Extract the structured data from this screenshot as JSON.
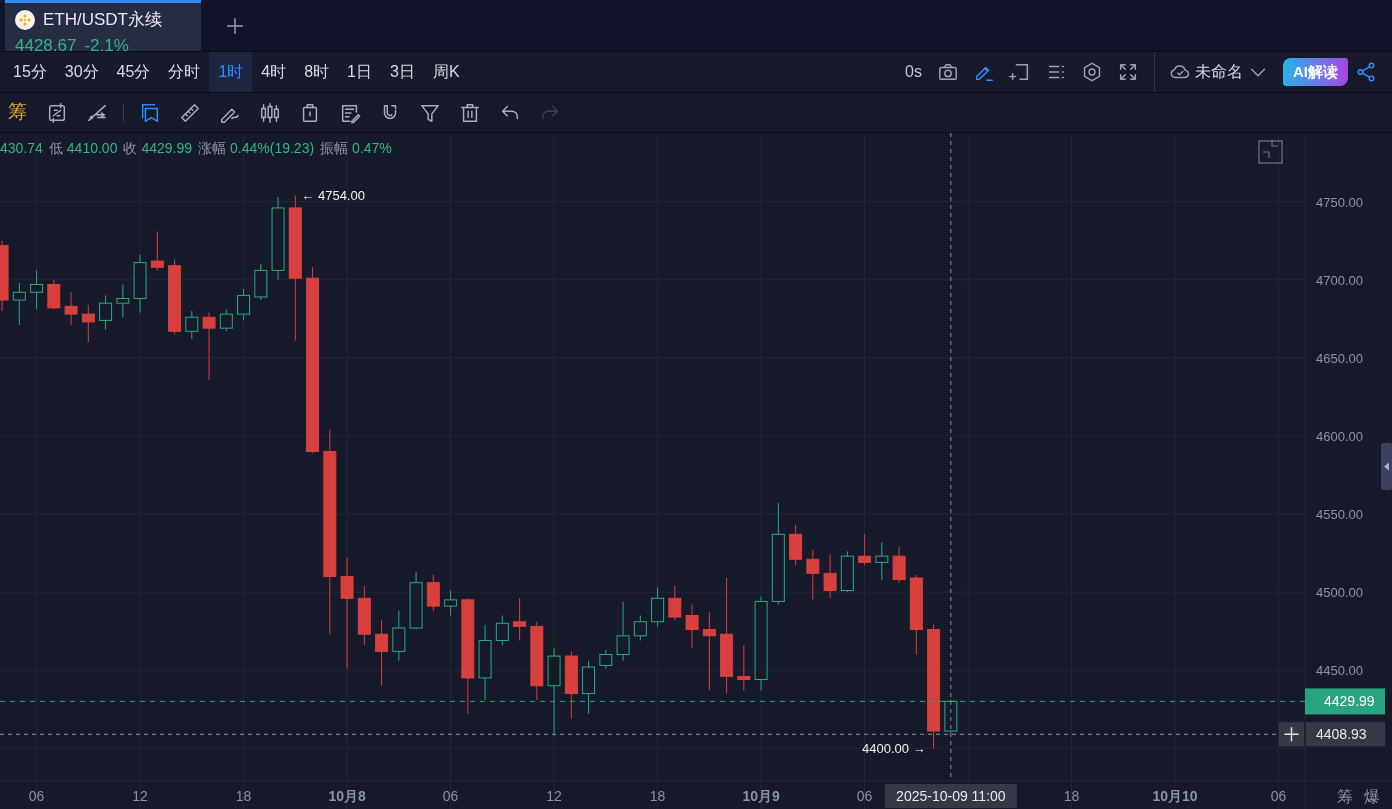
{
  "tabs": [
    {
      "symbol": "ETH/USDT永续",
      "price": "4428.67",
      "change": "-2.1%",
      "selected": true
    }
  ],
  "timeframes": [
    {
      "label": "15分",
      "selected": false
    },
    {
      "label": "30分",
      "selected": false
    },
    {
      "label": "45分",
      "selected": false
    },
    {
      "label": "分时",
      "selected": false
    },
    {
      "label": "1时",
      "selected": true
    },
    {
      "label": "4时",
      "selected": false
    },
    {
      "label": "8时",
      "selected": false
    },
    {
      "label": "1日",
      "selected": false
    },
    {
      "label": "3日",
      "selected": false
    },
    {
      "label": "周K",
      "selected": false
    }
  ],
  "header_tools": {
    "countdown": "0s",
    "icons": [
      {
        "kind": "camera",
        "active": false
      },
      {
        "kind": "pencil",
        "active": true
      },
      {
        "kind": "frame",
        "active": false
      },
      {
        "kind": "list",
        "active": false
      },
      {
        "kind": "settings",
        "active": false
      },
      {
        "kind": "fullscreen",
        "active": false
      }
    ],
    "layout_name": "未命名",
    "ai_button": "AI解读"
  },
  "drawing_toolbar": {
    "chip_label": "筹",
    "tools": [
      {
        "kind": "sync",
        "active": false,
        "disabled": false
      },
      {
        "kind": "trend",
        "active": false,
        "disabled": false
      },
      {
        "kind": "bookmark",
        "active": true,
        "disabled": false
      },
      {
        "kind": "ruler",
        "active": false,
        "disabled": false
      },
      {
        "kind": "brush",
        "active": false,
        "disabled": false
      },
      {
        "kind": "candles",
        "active": false,
        "disabled": false
      },
      {
        "kind": "lock",
        "active": false,
        "disabled": false
      },
      {
        "kind": "note",
        "active": false,
        "disabled": false
      },
      {
        "kind": "magnet",
        "active": false,
        "disabled": false
      },
      {
        "kind": "filter",
        "active": false,
        "disabled": false
      },
      {
        "kind": "trash",
        "active": false,
        "disabled": false
      },
      {
        "kind": "undo",
        "active": false,
        "disabled": false
      },
      {
        "kind": "redo",
        "active": false,
        "disabled": true
      }
    ]
  },
  "ohlc_info": [
    {
      "value": "430.74"
    },
    {
      "label": "低",
      "value": "4410.00"
    },
    {
      "label": "收",
      "value": "4429.99"
    },
    {
      "label": "涨幅",
      "value": "0.44%(19.23)"
    },
    {
      "label": "振幅",
      "value": "0.47%"
    }
  ],
  "chart": {
    "chart_data": {
      "type": "candlestick",
      "ylim": [
        4379,
        4794
      ],
      "yticks": [
        {
          "value": 4450,
          "label": "4450.00"
        },
        {
          "value": 4500,
          "label": "4500.00"
        },
        {
          "value": 4550,
          "label": "4550.00"
        },
        {
          "value": 4600,
          "label": "4600.00"
        },
        {
          "value": 4650,
          "label": "4650.00"
        },
        {
          "value": 4700,
          "label": "4700.00"
        },
        {
          "value": 4750,
          "label": "4750.00"
        }
      ],
      "categories": [
        null,
        null,
        "06",
        null,
        null,
        null,
        null,
        null,
        "12",
        null,
        null,
        null,
        null,
        null,
        "18",
        null,
        null,
        null,
        null,
        null,
        "10月8",
        null,
        null,
        null,
        null,
        null,
        "06",
        null,
        null,
        null,
        null,
        null,
        "12",
        null,
        null,
        null,
        null,
        null,
        "18",
        null,
        null,
        null,
        null,
        null,
        "10月9",
        null,
        null,
        null,
        null,
        null,
        "06",
        null,
        null,
        null,
        null,
        null,
        null,
        null,
        null,
        null,
        null,
        null,
        "18",
        null,
        null,
        null,
        null,
        null,
        "10月10",
        null,
        null,
        null,
        null,
        null,
        "06",
        null
      ],
      "ohlc": [
        [
          4722,
          4725,
          4680,
          4687
        ],
        [
          4687,
          4698,
          4671,
          4692
        ],
        [
          4692,
          4706,
          4681,
          4697
        ],
        [
          4697,
          4700,
          4681,
          4682
        ],
        [
          4683,
          4692,
          4671,
          4678
        ],
        [
          4678,
          4684,
          4660,
          4673
        ],
        [
          4674,
          4690,
          4668,
          4685
        ],
        [
          4685,
          4697,
          4676,
          4688
        ],
        [
          4688,
          4716,
          4679,
          4711
        ],
        [
          4712,
          4731,
          4706,
          4708
        ],
        [
          4709,
          4713,
          4665,
          4667
        ],
        [
          4667,
          4680,
          4662,
          4676
        ],
        [
          4676,
          4679,
          4636,
          4669
        ],
        [
          4669,
          4681,
          4667,
          4678
        ],
        [
          4678,
          4694,
          4674,
          4690
        ],
        [
          4689,
          4710,
          4687,
          4706
        ],
        [
          4706,
          4753,
          4700,
          4746
        ],
        [
          4746,
          4754,
          4661,
          4701
        ],
        [
          4701,
          4708,
          4589,
          4590
        ],
        [
          4590,
          4604,
          4473,
          4510
        ],
        [
          4510,
          4522,
          4451,
          4496
        ],
        [
          4496,
          4504,
          4466,
          4473
        ],
        [
          4473,
          4482,
          4440,
          4462
        ],
        [
          4462,
          4488,
          4456,
          4477
        ],
        [
          4477,
          4513,
          4476,
          4506
        ],
        [
          4506,
          4511,
          4488,
          4491
        ],
        [
          4491,
          4501,
          4485,
          4495
        ],
        [
          4495,
          4496,
          4422,
          4445
        ],
        [
          4445,
          4479,
          4431,
          4469
        ],
        [
          4469,
          4485,
          4466,
          4480
        ],
        [
          4481,
          4496,
          4469,
          4478
        ],
        [
          4478,
          4481,
          4431,
          4440
        ],
        [
          4440,
          4464,
          4408,
          4459
        ],
        [
          4459,
          4462,
          4419,
          4435
        ],
        [
          4435,
          4456,
          4422,
          4452
        ],
        [
          4453,
          4463,
          4451,
          4460
        ],
        [
          4460,
          4494,
          4456,
          4472
        ],
        [
          4472,
          4485,
          4469,
          4481
        ],
        [
          4481,
          4503,
          4478,
          4496
        ],
        [
          4496,
          4504,
          4482,
          4484
        ],
        [
          4485,
          4492,
          4464,
          4476
        ],
        [
          4476,
          4487,
          4437,
          4472
        ],
        [
          4473,
          4509,
          4435,
          4446
        ],
        [
          4446,
          4466,
          4437,
          4444
        ],
        [
          4444,
          4497,
          4437,
          4494
        ],
        [
          4494,
          4557,
          4492,
          4537
        ],
        [
          4537,
          4543,
          4517,
          4521
        ],
        [
          4521,
          4527,
          4495,
          4512
        ],
        [
          4512,
          4524,
          4496,
          4501
        ],
        [
          4501,
          4526,
          4500,
          4523
        ],
        [
          4523,
          4537,
          4517,
          4519
        ],
        [
          4519,
          4532,
          4508,
          4523
        ],
        [
          4523,
          4529,
          4506,
          4508
        ],
        [
          4509,
          4511,
          4460,
          4476
        ],
        [
          4476,
          4479,
          4400,
          4411
        ],
        [
          4411,
          4431,
          4410,
          4430
        ],
        null,
        null,
        null,
        null,
        null,
        null,
        null,
        null,
        null,
        null,
        null,
        null,
        null,
        null,
        null,
        null,
        null,
        null,
        null,
        null
      ],
      "annotations": [
        "← 4754.00",
        "4400.00 →"
      ],
      "grid": true,
      "ref_lines": [
        {
          "axis": "y",
          "value": 4429.99,
          "label": "4429.99"
        },
        {
          "axis": "y",
          "value": 4408.93,
          "label": "4408.93"
        }
      ]
    },
    "crosshair_time_label": "2025-10-09 11:00",
    "corner_labels": [
      "筹",
      "爆"
    ]
  }
}
